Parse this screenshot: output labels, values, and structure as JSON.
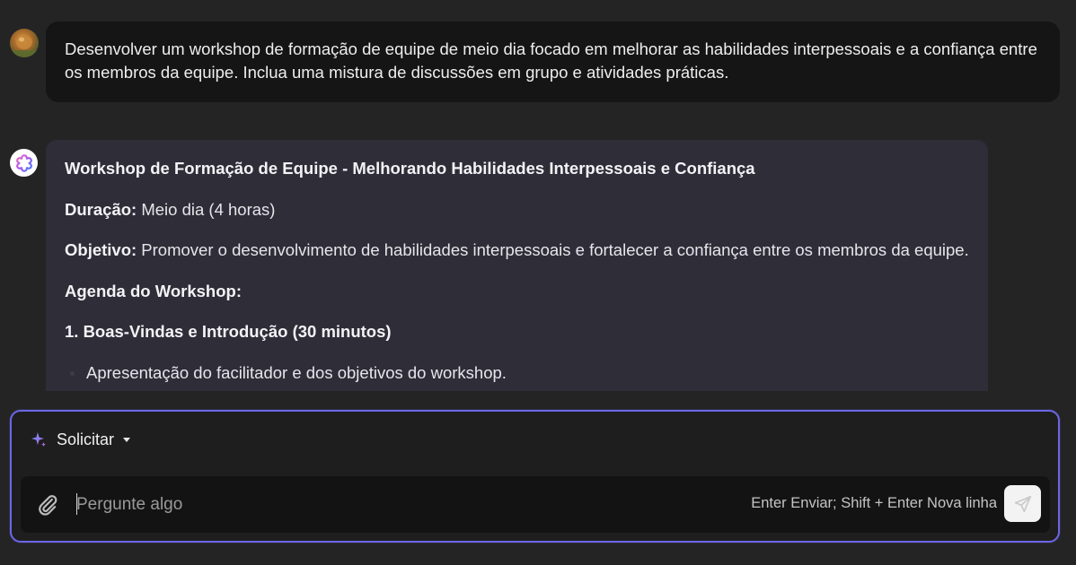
{
  "user_message": {
    "avatar_icon": "user-avatar-photo",
    "text": "Desenvolver um workshop de formação de equipe de meio dia focado em melhorar as habilidades interpessoais e a confiança entre os membros da equipe. Inclua uma mistura de discussões em grupo e atividades práticas."
  },
  "assistant_message": {
    "avatar_icon": "assistant-logo-icon",
    "title": "Workshop de Formação de Equipe - Melhorando Habilidades Interpessoais e Confiança",
    "duration_label": "Duração:",
    "duration_value": " Meio dia (4 horas)",
    "objective_label": "Objetivo:",
    "objective_value": " Promover o desenvolvimento de habilidades interpessoais e fortalecer a confiança entre os membros da equipe.",
    "agenda_heading": "Agenda do Workshop:",
    "section_1_heading": "1. Boas-Vindas e Introdução (30 minutos)",
    "section_1_items": [
      "Apresentação do facilitador e dos objetivos do workshop."
    ]
  },
  "composer": {
    "mode_icon": "sparkle-icon",
    "mode_label": "Solicitar",
    "attach_icon": "paperclip-icon",
    "input_value": "",
    "input_placeholder": "Pergunte algo",
    "hint": "Enter Enviar; Shift + Enter Nova linha",
    "send_icon": "send-icon"
  },
  "colors": {
    "background": "#242424",
    "user_bubble": "#151515",
    "assistant_bubble": "#2e2d38",
    "composer_border": "#6b67e6",
    "sparkle": "#8b7cf6"
  }
}
